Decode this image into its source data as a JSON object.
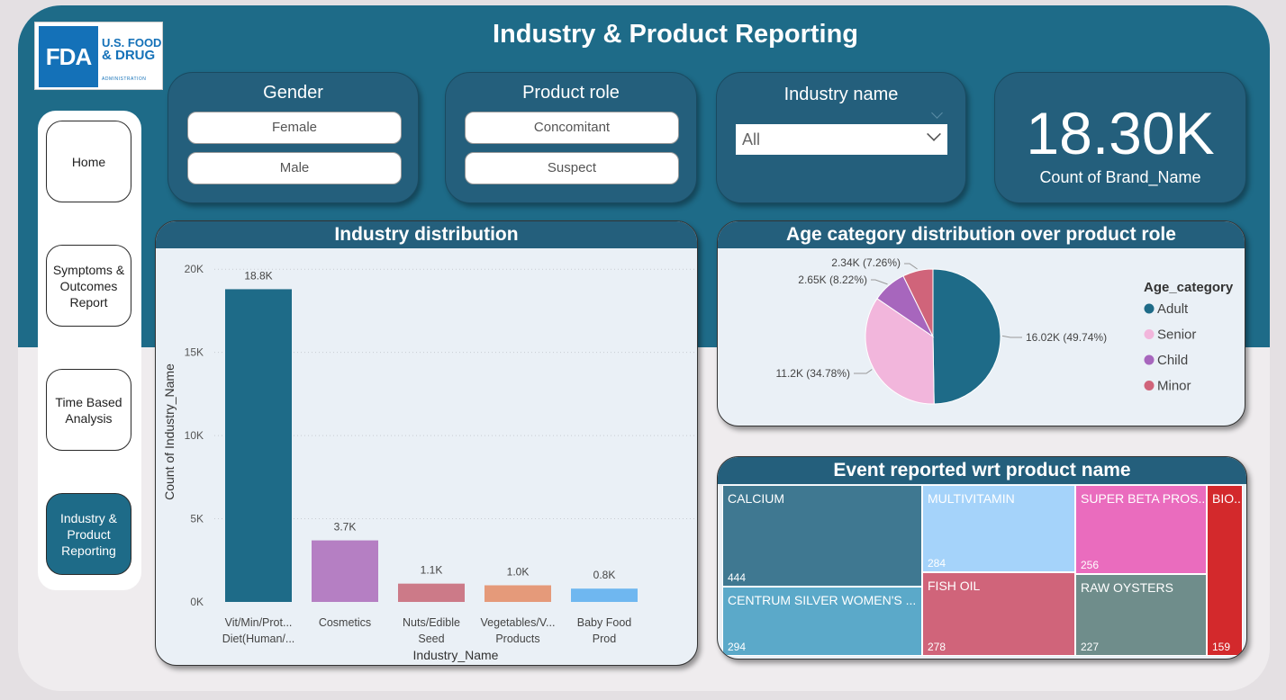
{
  "header": {
    "title": "Industry & Product Reporting"
  },
  "logo": {
    "mark": "FDA",
    "line1": "U.S. FOOD",
    "line2": "& DRUG",
    "line3": "ADMINISTRATION"
  },
  "nav": {
    "items": [
      {
        "label": "Home",
        "active": false
      },
      {
        "label": "Symptoms & Outcomes Report",
        "active": false
      },
      {
        "label": "Time Based Analysis",
        "active": false
      },
      {
        "label": "Industry & Product Reporting",
        "active": true
      }
    ]
  },
  "filters": {
    "gender": {
      "title": "Gender",
      "options": [
        "Female",
        "Male"
      ]
    },
    "product_role": {
      "title": "Product role",
      "options": [
        "Concomitant",
        "Suspect"
      ]
    },
    "industry_name": {
      "title": "Industry name",
      "selected": "All"
    }
  },
  "kpi": {
    "value": "18.30K",
    "label": "Count of Brand_Name"
  },
  "panels": {
    "industry": {
      "title": "Industry distribution"
    },
    "age": {
      "title": "Age category distribution over product role"
    },
    "events": {
      "title": "Event reported wrt product name"
    }
  },
  "chart_data": [
    {
      "type": "bar",
      "title": "Industry distribution",
      "xlabel": "Industry_Name",
      "ylabel": "Count of Industry_Name",
      "categories": [
        [
          "Vit/Min/Prot...",
          "Diet(Human/..."
        ],
        [
          "Cosmetics"
        ],
        [
          "Nuts/Edible",
          "Seed"
        ],
        [
          "Vegetables/V...",
          "Products"
        ],
        [
          "Baby Food",
          "Prod"
        ]
      ],
      "values": [
        18800,
        3700,
        1100,
        1000,
        800
      ],
      "data_labels": [
        "18.8K",
        "3.7K",
        "1.1K",
        "1.0K",
        "0.8K"
      ],
      "colors": [
        "#1e6b88",
        "#b57fc3",
        "#cc7a88",
        "#e59a7a",
        "#6fb7f0"
      ],
      "yticks": [
        0,
        5000,
        10000,
        15000,
        20000
      ],
      "ytick_labels": [
        "0K",
        "5K",
        "10K",
        "15K",
        "20K"
      ],
      "ylim": [
        0,
        20500
      ],
      "grid": true
    },
    {
      "type": "pie",
      "title": "Age category distribution over product role",
      "legend_title": "Age_category",
      "legend_position": "right",
      "slices": [
        {
          "name": "Adult",
          "value": 16020,
          "label": "16.02K (49.74%)",
          "color": "#1e6b88"
        },
        {
          "name": "Senior",
          "value": 11200,
          "label": "11.2K (34.78%)",
          "color": "#f2b6dc"
        },
        {
          "name": "Child",
          "value": 2650,
          "label": "2.65K (8.22%)",
          "color": "#a766bd"
        },
        {
          "name": "Minor",
          "value": 2340,
          "label": "2.34K (7.26%)",
          "color": "#d0647a"
        }
      ]
    },
    {
      "type": "treemap",
      "title": "Event reported wrt product name",
      "items": [
        {
          "name": "CALCIUM",
          "value": 444,
          "color": "#3f7891"
        },
        {
          "name": "CENTRUM SILVER WOMEN'S ...",
          "value": 294,
          "color": "#5ba9c9"
        },
        {
          "name": "MULTIVITAMIN",
          "value": 284,
          "color": "#a5d3fa"
        },
        {
          "name": "FISH OIL",
          "value": 278,
          "color": "#d0647a"
        },
        {
          "name": "SUPER BETA PROS...",
          "value": 256,
          "color": "#ea6cbe"
        },
        {
          "name": "RAW OYSTERS",
          "value": 227,
          "color": "#6f8d8b"
        },
        {
          "name": "BIO...",
          "value": 159,
          "color": "#d3292c"
        }
      ]
    }
  ]
}
